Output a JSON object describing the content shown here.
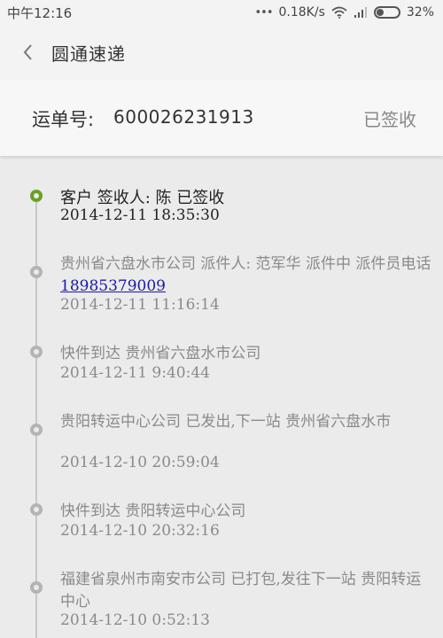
{
  "status_bar": {
    "time": "中午12:16",
    "network_speed": "0.18K/s",
    "battery": "32%",
    "battery_level": 0.32
  },
  "header": {
    "title": "圆通速递",
    "back_icon": "chevron-left-icon"
  },
  "waybill": {
    "label": "运单号:",
    "number": "600026231913",
    "status": "已签收"
  },
  "colors": {
    "current_node": "#6aa121",
    "past_node": "#b4b4b4",
    "link": "#1a1aa6"
  },
  "events": [
    {
      "desc": "客户 签收人: 陈 已签收",
      "time": "2014-12-11 18:35:30",
      "current": true
    },
    {
      "desc": "贵州省六盘水市公司 派件人: 范军华 派件中 派件员电话",
      "phone": "18985379009",
      "time": "2014-12-11 11:16:14"
    },
    {
      "desc": "快件到达 贵州省六盘水市公司",
      "time": "2014-12-11 9:40:44"
    },
    {
      "desc": "贵阳转运中心公司 已发出,下一站 贵州省六盘水市",
      "time": "2014-12-10 20:59:04"
    },
    {
      "desc": "快件到达 贵阳转运中心公司",
      "time": "2014-12-10 20:32:16"
    },
    {
      "desc": "福建省泉州市南安市公司 已打包,发往下一站 贵阳转运中心",
      "time": "2014-12-10 0:52:13"
    }
  ]
}
